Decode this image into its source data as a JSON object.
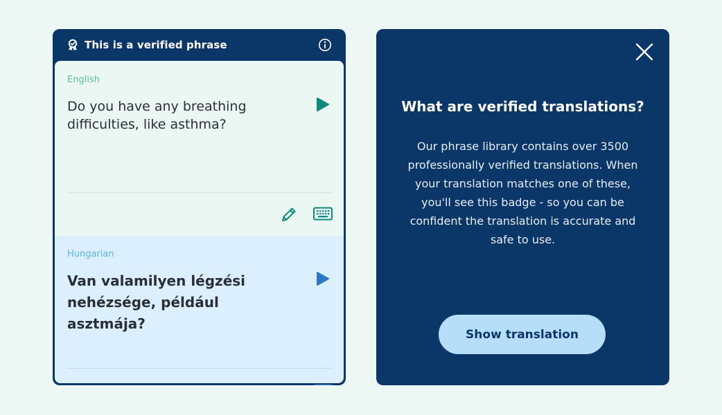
{
  "card": {
    "header": {
      "title": "This is a verified phrase",
      "badge_icon": "verified-badge-icon",
      "info_icon": "info-icon"
    },
    "source": {
      "language": "English",
      "text": "Do you have any breathing difficulties, like asthma?",
      "play_icon": "play-icon",
      "edit_icon": "pencil-icon",
      "keyboard_icon": "keyboard-icon"
    },
    "target": {
      "language": "Hungarian",
      "text": "Van valamilyen légzési nehézsége, például asztmája?",
      "play_icon": "play-icon",
      "keyboard_icon": "keyboard-icon"
    }
  },
  "modal": {
    "close_icon": "close-icon",
    "title": "What are verified translations?",
    "body": "Our phrase library contains over 3500 professionally verified translations. When your translation matches one of these, you'll see this badge - so you can be confident the translation is accurate and safe to use.",
    "button_label": "Show translation"
  },
  "colors": {
    "page_background": "#edf8f4",
    "navy": "#0b3668",
    "source_panel": "#eaf7f3",
    "target_panel": "#dcefff",
    "teal_accent": "#0e8a7c",
    "blue_accent": "#2b78c5",
    "button": "#b7def9"
  }
}
